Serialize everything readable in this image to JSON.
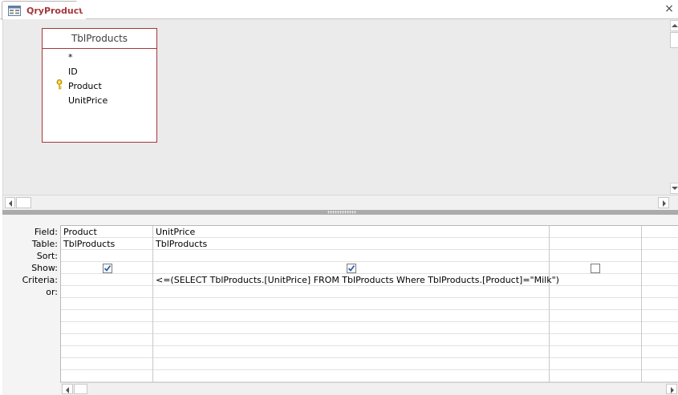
{
  "document_tab": {
    "title": "QryProducts",
    "icon": "query-icon",
    "close_label": "×"
  },
  "table_box": {
    "title": "TblProducts",
    "fields": [
      "*",
      "ID",
      "Product",
      "UnitPrice"
    ],
    "primary_key_field": "Product"
  },
  "design_grid": {
    "row_labels": [
      "Field:",
      "Table:",
      "Sort:",
      "Show:",
      "Criteria:",
      "or:"
    ],
    "columns": [
      {
        "field": "Product",
        "table": "TblProducts",
        "sort": "",
        "show": true,
        "criteria": "",
        "or": ""
      },
      {
        "field": "UnitPrice",
        "table": "TblProducts",
        "sort": "",
        "show": true,
        "criteria": "<=(SELECT TblProducts.[UnitPrice] FROM TblProducts Where TblProducts.[Product]=\"Milk\")",
        "or": ""
      },
      {
        "field": "",
        "table": "",
        "sort": "",
        "show": false,
        "criteria": "",
        "or": ""
      }
    ]
  },
  "colors": {
    "accent": "#a4373a",
    "pane_background": "#ebebeb",
    "splitter": "#ababab"
  }
}
